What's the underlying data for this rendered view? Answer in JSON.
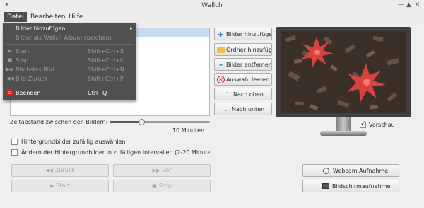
{
  "window": {
    "title": "Wallch"
  },
  "menubar": {
    "items": [
      "Datei",
      "Bearbeiten",
      "Hilfe"
    ]
  },
  "menu_datei": {
    "add_images": "Bilder hinzufügen",
    "save_album": "Bilder als Wallch Album speichern",
    "start": "Start",
    "start_shortcut": "Shift+Ctrl+S",
    "stop": "Stop",
    "stop_shortcut": "Shift+Ctrl+O",
    "next": "Nächstes Bild",
    "next_shortcut": "Shift+Ctrl+N",
    "prev": "Bild Zurück",
    "prev_shortcut": "Shift+Ctrl+P",
    "quit": "Beenden",
    "quit_shortcut": "Ctrl+Q"
  },
  "side_buttons": {
    "add_images": "Bilder hinzufügen",
    "add_folder": "Ordner hinzufügen",
    "remove_images": "Bilder entfernen",
    "clear_selection": "Auswahl leeren",
    "move_up": "Nach oben",
    "move_down": "Nach unten"
  },
  "interval": {
    "label": "Zeitabstand zwischen den Bildern:",
    "value": "10 Minuten",
    "slider_fraction": 0.32
  },
  "options": {
    "random_images": "Hintergrundbilder zufällig auswählen",
    "random_intervals": "Ändern der Hintergrundbilder in zufälligen Intervallen (2-20 Minuten)"
  },
  "preview": {
    "checkbox_label": "Vorschau",
    "checked": true
  },
  "controls": {
    "back": "Zurück",
    "forward": "Vor",
    "start": "Start",
    "stop": "Stop"
  },
  "capture": {
    "webcam": "Webcam Aufnahme",
    "screenshot": "Bildschirmaufnahme"
  },
  "colors": {
    "menu_bg": "#505050",
    "selection": "#c9d9ee",
    "flower": "#d9423f"
  }
}
